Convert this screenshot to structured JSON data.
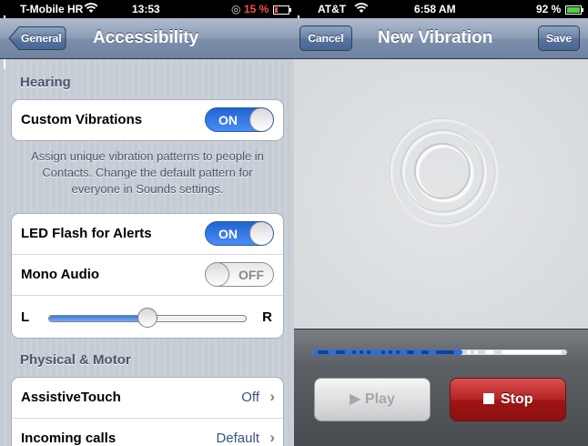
{
  "left": {
    "status": {
      "carrier": "T-Mobile HR",
      "time": "13:53",
      "battery": "15 %"
    },
    "nav": {
      "back_label": "General",
      "title": "Accessibility"
    },
    "hearing": {
      "header": "Hearing",
      "custom_vibrations": {
        "label": "Custom Vibrations",
        "switch_text": "ON",
        "on": true
      },
      "footer": "Assign unique vibration patterns to people in Contacts. Change the default pattern for everyone in Sounds settings.",
      "led_flash": {
        "label": "LED Flash for Alerts",
        "switch_text": "ON",
        "on": true
      },
      "mono_audio": {
        "label": "Mono Audio",
        "switch_text": "OFF",
        "on": false
      },
      "balance": {
        "left_label": "L",
        "right_label": "R",
        "level": 0.5
      }
    },
    "physical": {
      "header": "Physical & Motor",
      "assistive_touch": {
        "label": "AssistiveTouch",
        "value": "Off"
      },
      "incoming_calls": {
        "label": "Incoming calls",
        "value": "Default"
      }
    }
  },
  "right": {
    "status": {
      "carrier": "AT&T",
      "time": "6:58 AM",
      "battery": "92 %"
    },
    "nav": {
      "cancel_label": "Cancel",
      "title": "New Vibration",
      "save_label": "Save"
    },
    "playback": {
      "play_label": "Play",
      "stop_label": "Stop",
      "progress": 0.59
    }
  },
  "colors": {
    "accent_blue": "#2f6fd8",
    "stop_red": "#b52222",
    "nav_blue": "#6d83a1"
  }
}
